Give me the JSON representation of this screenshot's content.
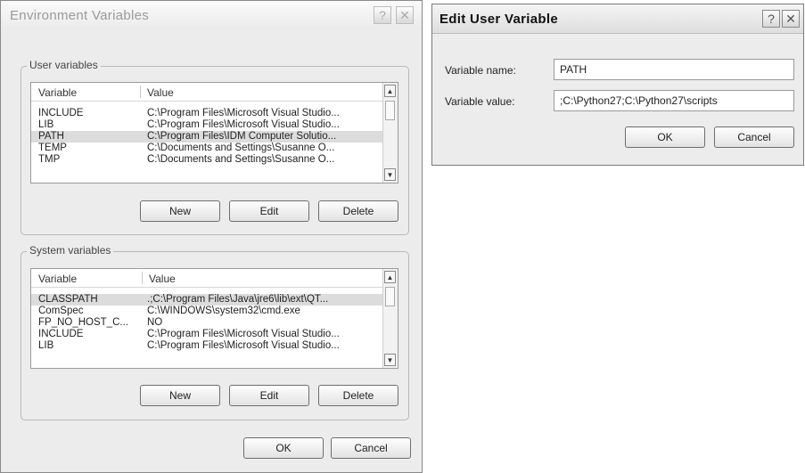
{
  "env_dialog": {
    "title": "Environment Variables",
    "help": "?",
    "close": "✕",
    "user_group_label": "User variables",
    "system_group_label": "System variables",
    "col_variable": "Variable",
    "col_value": "Value",
    "user_rows": [
      {
        "name": "INCLUDE",
        "value": "C:\\Program Files\\Microsoft Visual Studio..."
      },
      {
        "name": "LIB",
        "value": "C:\\Program Files\\Microsoft Visual Studio..."
      },
      {
        "name": "PATH",
        "value": "C:\\Program Files\\IDM Computer Solutio..."
      },
      {
        "name": "TEMP",
        "value": "C:\\Documents and Settings\\Susanne O..."
      },
      {
        "name": "TMP",
        "value": "C:\\Documents and Settings\\Susanne O..."
      }
    ],
    "system_rows": [
      {
        "name": "CLASSPATH",
        "value": ".;C:\\Program Files\\Java\\jre6\\lib\\ext\\QT..."
      },
      {
        "name": "ComSpec",
        "value": "C:\\WINDOWS\\system32\\cmd.exe"
      },
      {
        "name": "FP_NO_HOST_C...",
        "value": "NO"
      },
      {
        "name": "INCLUDE",
        "value": "C:\\Program Files\\Microsoft Visual Studio..."
      },
      {
        "name": "LIB",
        "value": "C:\\Program Files\\Microsoft Visual Studio..."
      }
    ],
    "new_label": "New",
    "edit_label": "Edit",
    "delete_label": "Delete",
    "ok_label": "OK",
    "cancel_label": "Cancel"
  },
  "edit_dialog": {
    "title": "Edit User Variable",
    "help": "?",
    "close": "✕",
    "name_label": "Variable name:",
    "name_value": "PATH",
    "value_label": "Variable value:",
    "value_value": ";C:\\Python27;C:\\Python27\\scripts",
    "ok_label": "OK",
    "cancel_label": "Cancel"
  },
  "icons": {
    "scroll_up": "▲",
    "scroll_down": "▼"
  }
}
